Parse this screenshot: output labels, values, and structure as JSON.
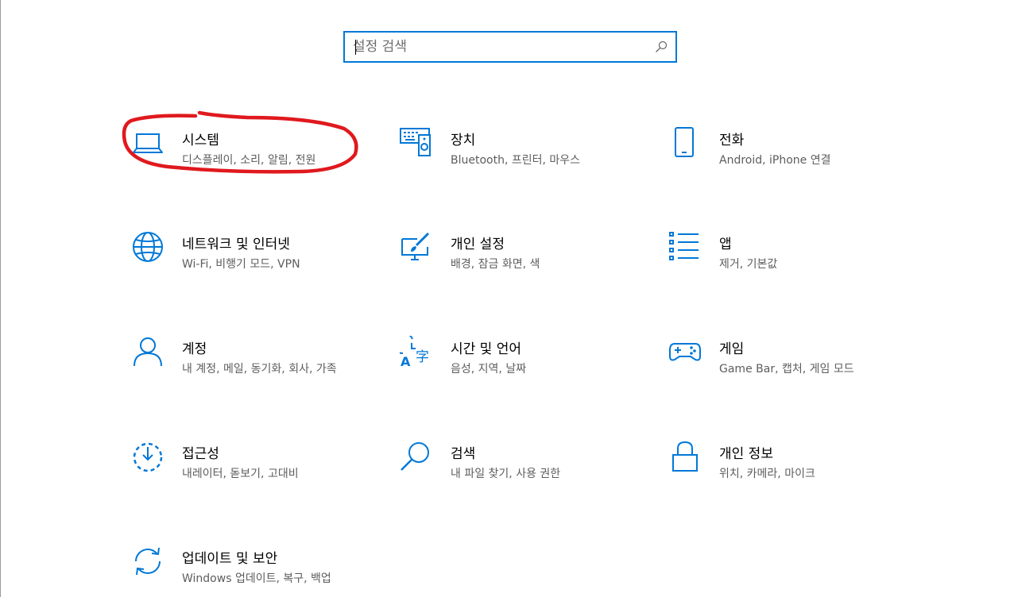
{
  "search": {
    "placeholder": "설정 검색",
    "value": ""
  },
  "tiles": [
    {
      "title": "시스템",
      "desc": "디스플레이, 소리, 알림, 전원",
      "icon": "laptop-icon"
    },
    {
      "title": "장치",
      "desc": "Bluetooth, 프린터, 마우스",
      "icon": "devices-icon"
    },
    {
      "title": "전화",
      "desc": "Android, iPhone 연결",
      "icon": "phone-icon"
    },
    {
      "title": "네트워크 및 인터넷",
      "desc": "Wi-Fi, 비행기 모드, VPN",
      "icon": "globe-icon"
    },
    {
      "title": "개인 설정",
      "desc": "배경, 잠금 화면, 색",
      "icon": "paint-brush-icon"
    },
    {
      "title": "앱",
      "desc": "제거, 기본값",
      "icon": "apps-list-icon"
    },
    {
      "title": "계정",
      "desc": "내 계정, 메일, 동기화, 회사, 가족",
      "icon": "person-icon"
    },
    {
      "title": "시간 및 언어",
      "desc": "음성, 지역, 날짜",
      "icon": "time-language-icon"
    },
    {
      "title": "게임",
      "desc": "Game Bar, 캡처, 게임 모드",
      "icon": "gamepad-icon"
    },
    {
      "title": "접근성",
      "desc": "내레이터, 돋보기, 고대비",
      "icon": "ease-of-access-icon"
    },
    {
      "title": "검색",
      "desc": "내 파일 찾기, 사용 권한",
      "icon": "search-icon"
    },
    {
      "title": "개인 정보",
      "desc": "위치, 카메라, 마이크",
      "icon": "lock-icon"
    },
    {
      "title": "업데이트 및 보안",
      "desc": "Windows 업데이트, 복구, 백업",
      "icon": "sync-icon"
    }
  ],
  "colors": {
    "accent": "#0078d7",
    "annotation": "#e0191e"
  }
}
